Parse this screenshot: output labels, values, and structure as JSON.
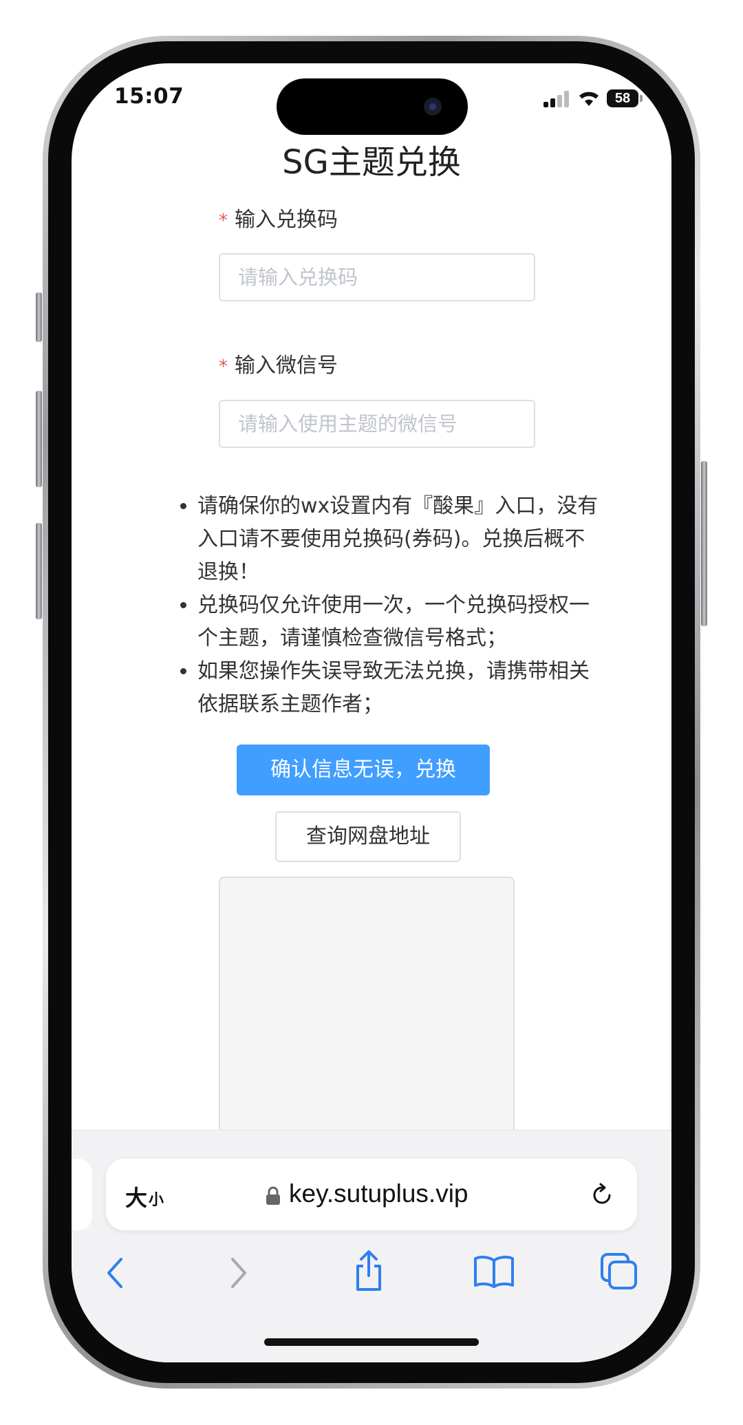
{
  "status_bar": {
    "time": "15:07",
    "battery": "58"
  },
  "page": {
    "title": "SG主题兑换",
    "code_field": {
      "required_mark": "*",
      "label": "输入兑换码",
      "placeholder": "请输入兑换码"
    },
    "wechat_field": {
      "required_mark": "*",
      "label": "输入微信号",
      "placeholder": "请输入使用主题的微信号"
    },
    "notices": [
      "请确保你的wx设置内有『酸果』入口，没有入口请不要使用兑换码(券码)。兑换后概不退换！",
      "兑换码仅允许使用一次，一个兑换码授权一个主题，请谨慎检查微信号格式；",
      "如果您操作失误导致无法兑换，请携带相关依据联系主题作者；"
    ],
    "confirm_button": "确认信息无误，兑换",
    "query_button": "查询网盘地址"
  },
  "browser": {
    "aa_big": "大",
    "aa_small": "小",
    "url": "key.sutuplus.vip",
    "toolbar_icons": [
      "back-icon",
      "forward-icon",
      "share-icon",
      "bookmarks-icon",
      "tabs-icon"
    ]
  },
  "colors": {
    "primary": "#409eff",
    "required": "#e05a5a",
    "border": "#dcdfe6",
    "placeholder": "#c0c4cc"
  }
}
